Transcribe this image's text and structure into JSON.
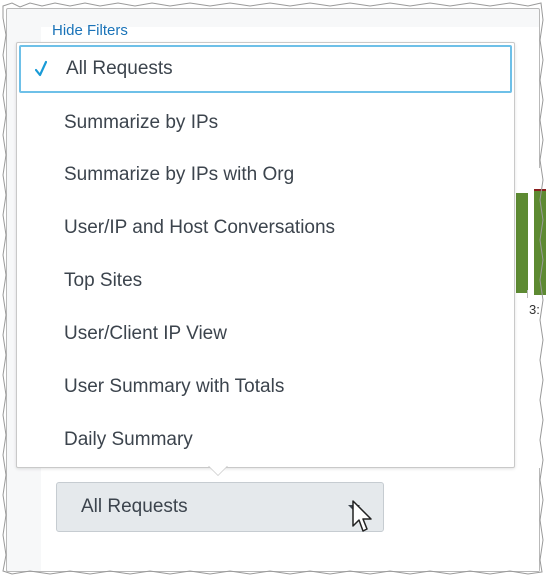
{
  "filters": {
    "toggle_label": "Hide Filters"
  },
  "menu": {
    "items": [
      {
        "label": "All Requests",
        "selected": true
      },
      {
        "label": "Summarize by IPs",
        "selected": false
      },
      {
        "label": "Summarize by IPs with Org",
        "selected": false
      },
      {
        "label": "User/IP and Host Conversations",
        "selected": false
      },
      {
        "label": "Top Sites",
        "selected": false
      },
      {
        "label": "User/Client IP View",
        "selected": false
      },
      {
        "label": "User Summary with Totals",
        "selected": false
      },
      {
        "label": "Daily Summary",
        "selected": false
      }
    ]
  },
  "select": {
    "value": "All Requests"
  },
  "chart": {
    "axis_label": "3:"
  },
  "colors": {
    "accent": "#1a73b8",
    "selected_border": "#6ec0e8",
    "bar_green": "#5d8a32",
    "checkmark": "#1a9bd7"
  },
  "icons": {
    "check": "check-icon",
    "caret": "caret-down-icon",
    "cursor": "mouse-pointer-icon"
  }
}
